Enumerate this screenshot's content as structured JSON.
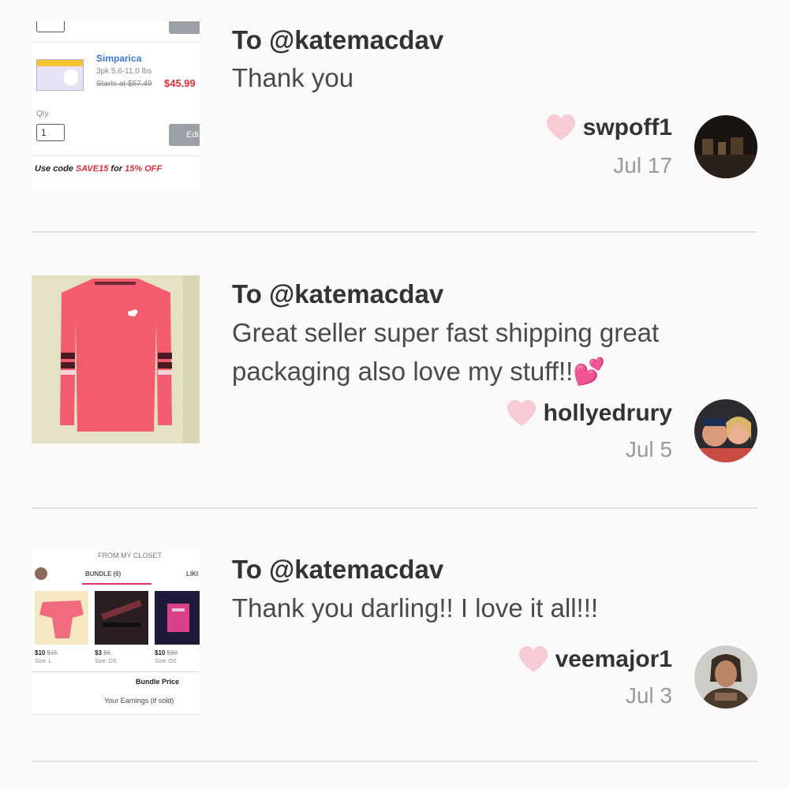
{
  "reviews": [
    {
      "to": "To @katemacdav",
      "message": "Thank you",
      "username": "swpoff1",
      "date": "Jul 17",
      "thumbnail": {
        "product_name": "Simparica",
        "product_size": "3pk 5.6-11.0 lbs",
        "price_original": "Starts at $57.49",
        "price_sale": "$45.99",
        "qty_label": "Qty",
        "qty_value": "1",
        "edit_label": "Edi",
        "promo_prefix": "Use code ",
        "promo_code": "SAVE15",
        "promo_middle": " for ",
        "promo_off": "15% OFF"
      }
    },
    {
      "to": "To @katemacdav",
      "message": "Great seller super fast shipping great packaging also love my stuff!!💕",
      "username": "hollyedrury",
      "date": "Jul 5"
    },
    {
      "to": "To @katemacdav",
      "message": "Thank you darling!! I love it all!!!",
      "username": "veemajor1",
      "date": "Jul 3",
      "thumbnail": {
        "header": "FROM MY CLOSET",
        "tab_bundle": "BUNDLE (6)",
        "tab_likes": "LIKI",
        "items": [
          {
            "price": "$10",
            "orig": "$15",
            "size": "Size: L"
          },
          {
            "price": "$3",
            "orig": "$6",
            "size": "Size: OS"
          },
          {
            "price": "$10",
            "orig": "$30",
            "size": "Size: OS"
          }
        ],
        "bundle_price": "Bundle Price",
        "your_earnings": "Your Earnings (if sold)"
      }
    }
  ],
  "colors": {
    "background": "#fbf9fa",
    "heart": "#f7cbd4",
    "divider": "#e2dfe0",
    "sale_red": "#e0303a",
    "link_blue": "#3a7bd5"
  }
}
